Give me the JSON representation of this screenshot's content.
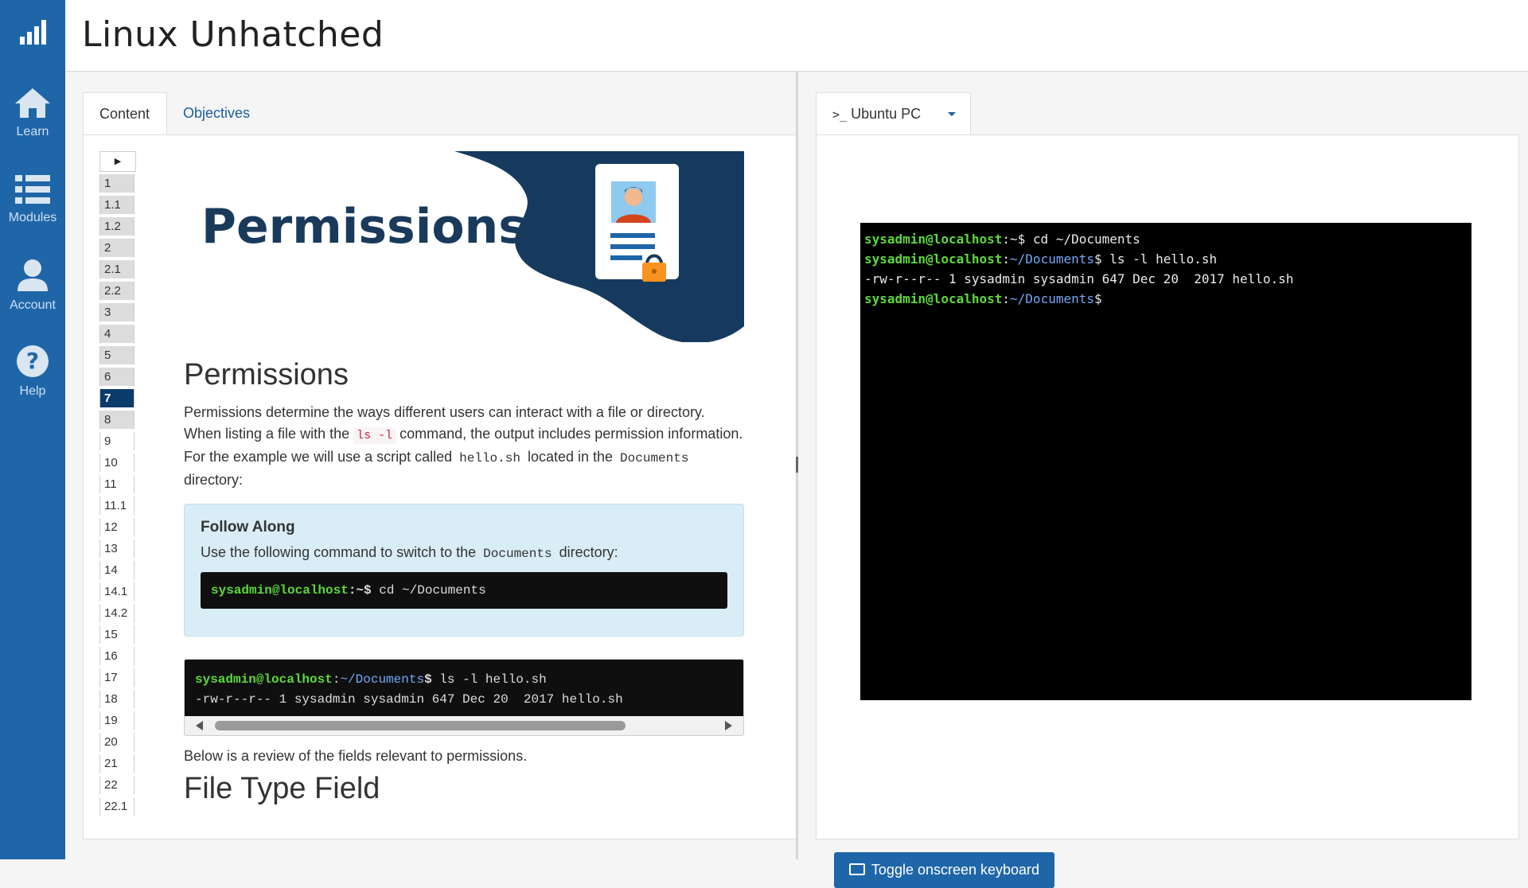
{
  "app": {
    "title": "Linux Unhatched"
  },
  "sidebar": {
    "items": [
      {
        "label": "Learn",
        "icon": "home-icon"
      },
      {
        "label": "Modules",
        "icon": "list-icon"
      },
      {
        "label": "Account",
        "icon": "user-icon"
      },
      {
        "label": "Help",
        "icon": "help-icon"
      }
    ]
  },
  "left": {
    "tabs": [
      {
        "label": "Content",
        "active": true
      },
      {
        "label": "Objectives",
        "active": false
      }
    ],
    "toc": {
      "items": [
        "1",
        "1.1",
        "1.2",
        "2",
        "2.1",
        "2.2",
        "3",
        "4",
        "5",
        "6",
        "7",
        "8",
        "9",
        "10",
        "11",
        "11.1",
        "12",
        "13",
        "14",
        "14.1",
        "14.2",
        "15",
        "16",
        "17",
        "18",
        "19",
        "20",
        "21",
        "22",
        "22.1"
      ],
      "active": "7"
    },
    "banner_title": "Permissions",
    "section_title": "Permissions",
    "paragraph": {
      "t1": "Permissions determine the ways different users can interact with a file or directory. When listing a file with the ",
      "code1": "ls -l",
      "t2": " command, the output includes permission information. For the example we will use a script called ",
      "code2": "hello.sh",
      "t3": " located in the ",
      "code3": "Documents",
      "t4": " directory:"
    },
    "follow_along": {
      "title": "Follow Along",
      "text_a": "Use the following command to switch to the ",
      "code": "Documents",
      "text_b": " directory:",
      "prompt_user": "sysadmin@localhost",
      "prompt_path": ":~$",
      "command": " cd ~/Documents"
    },
    "codeblock": {
      "prompt_user": "sysadmin@localhost",
      "prompt_colon": ":",
      "prompt_path": "~/Documents",
      "prompt_dollar": "$",
      "command": " ls -l hello.sh",
      "output": "-rw-r--r-- 1 sysadmin sysadmin 647 Dec 20  2017 hello.sh"
    },
    "review_text": "Below is a review of the fields relevant to permissions.",
    "next_heading": "File Type Field"
  },
  "right": {
    "vm_tab": "Ubuntu PC",
    "terminal": {
      "line1_user": "sysadmin@localhost",
      "line1_rest": ":~$ cd ~/Documents",
      "line2_user": "sysadmin@localhost",
      "line2_colon": ":",
      "line2_path": "~/Documents",
      "line2_rest": "$ ls -l hello.sh",
      "line3": "-rw-r--r-- 1 sysadmin sysadmin 647 Dec 20  2017 hello.sh",
      "line4_user": "sysadmin@localhost",
      "line4_colon": ":",
      "line4_path": "~/Documents",
      "line4_rest": "$"
    },
    "keyboard_button": "Toggle onscreen keyboard"
  },
  "colors": {
    "sidebar": "#1f66a9",
    "active_toc": "#0a3b6b",
    "banner": "#163a5e",
    "prompt_green": "#5cd83a",
    "path_blue": "#6fa8f5"
  }
}
